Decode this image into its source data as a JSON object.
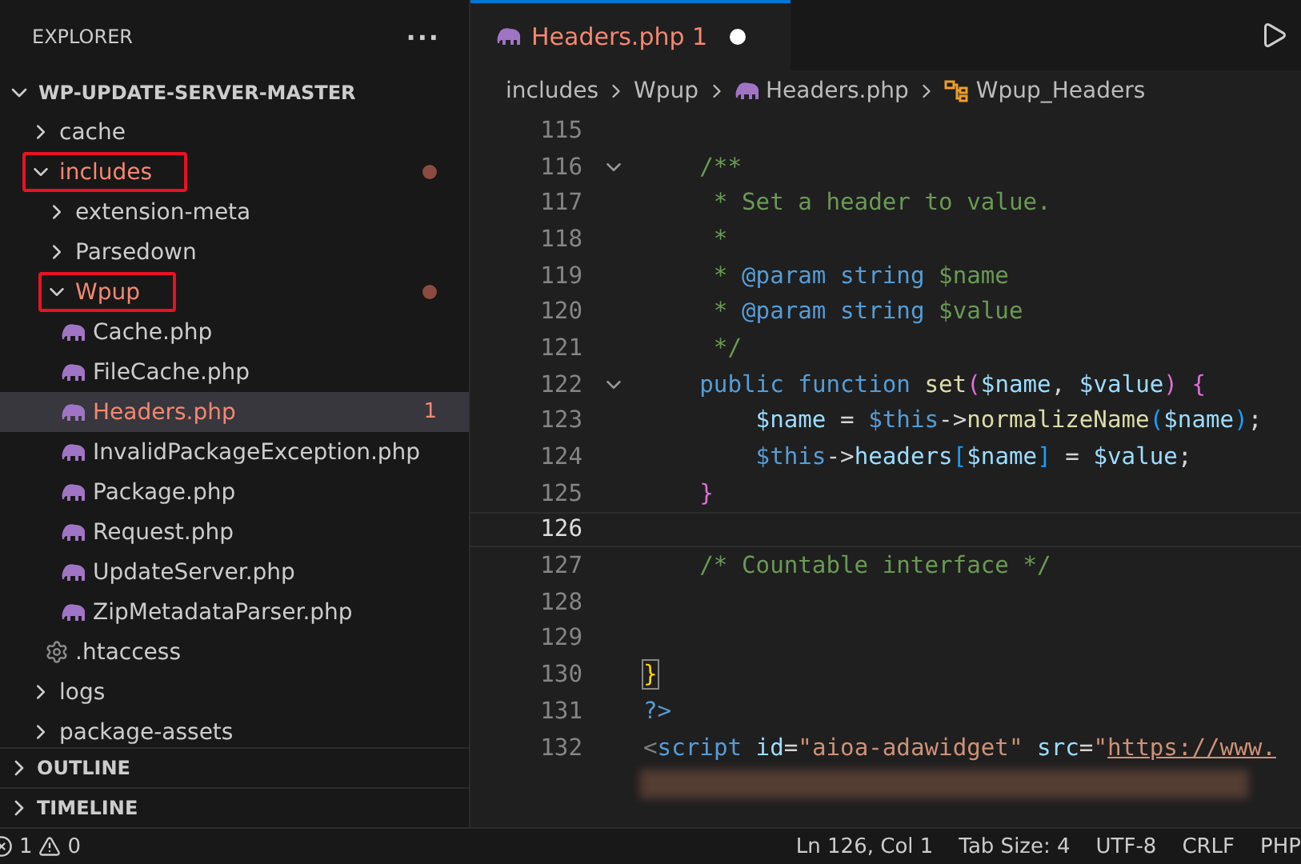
{
  "sidebar": {
    "title": "EXPLORER",
    "more": "···",
    "root": {
      "name": "WP-UPDATE-SERVER-MASTER",
      "expanded": true
    },
    "tree": [
      {
        "name": "cache",
        "kind": "folder",
        "expanded": false,
        "selected": false,
        "error": false,
        "boxed": false
      },
      {
        "name": "includes",
        "kind": "folder",
        "expanded": true,
        "selected": false,
        "error": true,
        "boxed": true,
        "children": [
          {
            "name": "extension-meta",
            "kind": "folder",
            "expanded": false,
            "selected": false,
            "error": false,
            "boxed": false
          },
          {
            "name": "Parsedown",
            "kind": "folder",
            "expanded": false,
            "selected": false,
            "error": false,
            "boxed": false
          },
          {
            "name": "Wpup",
            "kind": "folder",
            "expanded": true,
            "selected": false,
            "error": true,
            "boxed": true,
            "children": [
              {
                "name": "Cache.php",
                "kind": "php",
                "selected": false,
                "error": false,
                "boxed": false
              },
              {
                "name": "FileCache.php",
                "kind": "php",
                "selected": false,
                "error": false,
                "boxed": false
              },
              {
                "name": "Headers.php",
                "kind": "php",
                "selected": true,
                "error": true,
                "boxed": false,
                "badge": "1"
              },
              {
                "name": "InvalidPackageException.php",
                "kind": "php",
                "selected": false,
                "error": false,
                "boxed": false
              },
              {
                "name": "Package.php",
                "kind": "php",
                "selected": false,
                "error": false,
                "boxed": false
              },
              {
                "name": "Request.php",
                "kind": "php",
                "selected": false,
                "error": false,
                "boxed": false
              },
              {
                "name": "UpdateServer.php",
                "kind": "php",
                "selected": false,
                "error": false,
                "boxed": false
              },
              {
                "name": "ZipMetadataParser.php",
                "kind": "php",
                "selected": false,
                "error": false,
                "boxed": false
              }
            ]
          },
          {
            "name": ".htaccess",
            "kind": "config",
            "selected": false,
            "error": false,
            "boxed": false
          }
        ]
      },
      {
        "name": "logs",
        "kind": "folder",
        "expanded": false,
        "selected": false,
        "error": false,
        "boxed": false
      },
      {
        "name": "package-assets",
        "kind": "folder",
        "expanded": false,
        "selected": false,
        "error": false,
        "boxed": false
      }
    ],
    "panels": [
      {
        "title": "OUTLINE",
        "expanded": false
      },
      {
        "title": "TIMELINE",
        "expanded": false
      }
    ]
  },
  "editor": {
    "tabs": [
      {
        "label": "Headers.php",
        "problems": "1",
        "dirty": true,
        "selected": true
      }
    ],
    "breadcrumb": [
      {
        "label": "includes",
        "kind": "folder"
      },
      {
        "label": "Wpup",
        "kind": "folder"
      },
      {
        "label": "Headers.php",
        "kind": "php"
      },
      {
        "label": "Wpup_Headers",
        "kind": "class"
      }
    ],
    "lines": [
      {
        "number": "115",
        "fold": false,
        "current": false
      },
      {
        "number": "116",
        "fold": true,
        "current": false,
        "tokens": [
          {
            "text": "    /**",
            "kind": "comment"
          }
        ]
      },
      {
        "number": "117",
        "fold": false,
        "current": false,
        "tokens": [
          {
            "text": "     * Set a header to value.",
            "kind": "comment"
          }
        ]
      },
      {
        "number": "118",
        "fold": false,
        "current": false,
        "tokens": [
          {
            "text": "     *",
            "kind": "comment"
          }
        ]
      },
      {
        "number": "119",
        "fold": false,
        "current": false,
        "tokens": [
          {
            "text": "     *",
            "kind": "comment"
          },
          {
            "text": " @param",
            "kind": "keyword"
          },
          {
            "text": " string",
            "kind": "keyword"
          },
          {
            "text": " $name",
            "kind": "comment"
          }
        ]
      },
      {
        "number": "120",
        "fold": false,
        "current": false,
        "tokens": [
          {
            "text": "     *",
            "kind": "comment"
          },
          {
            "text": " @param",
            "kind": "keyword"
          },
          {
            "text": " string",
            "kind": "keyword"
          },
          {
            "text": " $value",
            "kind": "comment"
          }
        ]
      },
      {
        "number": "121",
        "fold": false,
        "current": false,
        "tokens": [
          {
            "text": "     */",
            "kind": "comment"
          }
        ]
      },
      {
        "number": "122",
        "fold": true,
        "current": false,
        "tokens": [
          {
            "text": "    public",
            "kind": "keyword"
          },
          {
            "text": " function",
            "kind": "keyword"
          },
          {
            "text": " set",
            "kind": "function"
          },
          {
            "text": "(",
            "kind": "bracket2"
          },
          {
            "text": "$name",
            "kind": "variable"
          },
          {
            "text": ",",
            "kind": "plain"
          },
          {
            "text": " $value",
            "kind": "variable"
          },
          {
            "text": ")",
            "kind": "bracket2"
          },
          {
            "text": " {",
            "kind": "bracket2"
          }
        ]
      },
      {
        "number": "123",
        "fold": false,
        "current": false,
        "tokens": [
          {
            "text": "        $name",
            "kind": "variable"
          },
          {
            "text": " = ",
            "kind": "plain"
          },
          {
            "text": "$this",
            "kind": "keyword"
          },
          {
            "text": "->",
            "kind": "plain"
          },
          {
            "text": "normalizeName",
            "kind": "function"
          },
          {
            "text": "(",
            "kind": "bracket3"
          },
          {
            "text": "$name",
            "kind": "variable"
          },
          {
            "text": ")",
            "kind": "bracket3"
          },
          {
            "text": ";",
            "kind": "plain"
          }
        ]
      },
      {
        "number": "124",
        "fold": false,
        "current": false,
        "tokens": [
          {
            "text": "        $this",
            "kind": "keyword"
          },
          {
            "text": "->",
            "kind": "plain"
          },
          {
            "text": "headers",
            "kind": "variable"
          },
          {
            "text": "[",
            "kind": "bracket3"
          },
          {
            "text": "$name",
            "kind": "variable"
          },
          {
            "text": "]",
            "kind": "bracket3"
          },
          {
            "text": " = ",
            "kind": "plain"
          },
          {
            "text": "$value",
            "kind": "variable"
          },
          {
            "text": ";",
            "kind": "plain"
          }
        ]
      },
      {
        "number": "125",
        "fold": false,
        "current": false,
        "tokens": [
          {
            "text": "    }",
            "kind": "bracket2"
          }
        ]
      },
      {
        "number": "126",
        "fold": false,
        "current": true
      },
      {
        "number": "127",
        "fold": false,
        "current": false,
        "tokens": [
          {
            "text": "    /* Countable interface */",
            "kind": "comment"
          }
        ]
      },
      {
        "number": "128",
        "fold": false,
        "current": false
      },
      {
        "number": "129",
        "fold": false,
        "current": false
      },
      {
        "number": "130",
        "fold": false,
        "current": false,
        "tokens": [
          {
            "text": "}",
            "kind": "bracket1"
          }
        ]
      },
      {
        "number": "131",
        "fold": false,
        "current": false,
        "tokens": [
          {
            "text": "?>",
            "kind": "keyword"
          }
        ]
      },
      {
        "number": "132",
        "fold": false,
        "current": false,
        "tokens": [
          {
            "text": "<",
            "kind": "tagpunct"
          },
          {
            "text": "script",
            "kind": "keyword"
          },
          {
            "text": " id",
            "kind": "variable"
          },
          {
            "text": "=",
            "kind": "plain"
          },
          {
            "text": "\"aioa-adawidget\"",
            "kind": "string"
          },
          {
            "text": " src",
            "kind": "variable"
          },
          {
            "text": "=",
            "kind": "plain"
          },
          {
            "text": "\"",
            "kind": "string"
          },
          {
            "text": "https://www.",
            "kind": "url"
          }
        ]
      }
    ]
  },
  "status_bar": {
    "errors": "1",
    "warnings": "0",
    "items": [
      "Ln 126, Col 1",
      "Tab Size: 4",
      "UTF-8",
      "CRLF",
      "PHP"
    ]
  }
}
